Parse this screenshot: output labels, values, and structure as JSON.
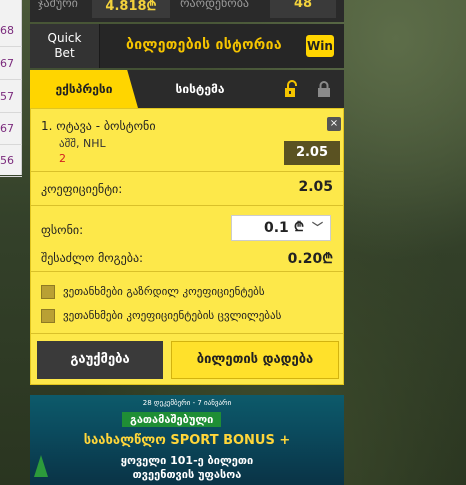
{
  "left_odds": [
    "68",
    "67",
    "57",
    "67",
    "56"
  ],
  "top_row": {
    "label1": "ჯამური",
    "value1": "4.818₾",
    "label2": "რაოდენობა",
    "value2": "48"
  },
  "quick_row": {
    "quick_bet": "Quick\nBet",
    "history_title": "ბილეთების ისტორია",
    "win_badge": "Win"
  },
  "tabs": {
    "express": "ექსპრესი",
    "system": "სისტემა"
  },
  "bet": {
    "name": "1. ოტავა - ბოსტონი",
    "league": "აშშ, NHL",
    "pick": "2",
    "odd": "2.05",
    "remove": "×"
  },
  "coefficient": {
    "label": "კოეფიციენტი:",
    "value": "2.05"
  },
  "stake": {
    "label": "ფსონი:",
    "value": "0.1",
    "currency": "₾",
    "chevron": "﹀"
  },
  "payout": {
    "label": "შესაძლო მოგება:",
    "value": "0.20₾"
  },
  "checkboxes": [
    "ვეთანხმები გაზრდილ კოეფიციენტებს",
    "ვეთანხმები კოეფიციენტების ცვლილებას"
  ],
  "buttons": {
    "cancel": "გაუქმება",
    "place": "ბილეთის დადება"
  },
  "banner": {
    "dates": "28 დეკემბერი - 7 იანვარი",
    "giveaway": "გათამაშებული",
    "headline": "საახალწლო SPORT BONUS +",
    "line3": "ყოველი 101-ე ბილეთი",
    "line4": "თვეენთვის უფასოა"
  }
}
